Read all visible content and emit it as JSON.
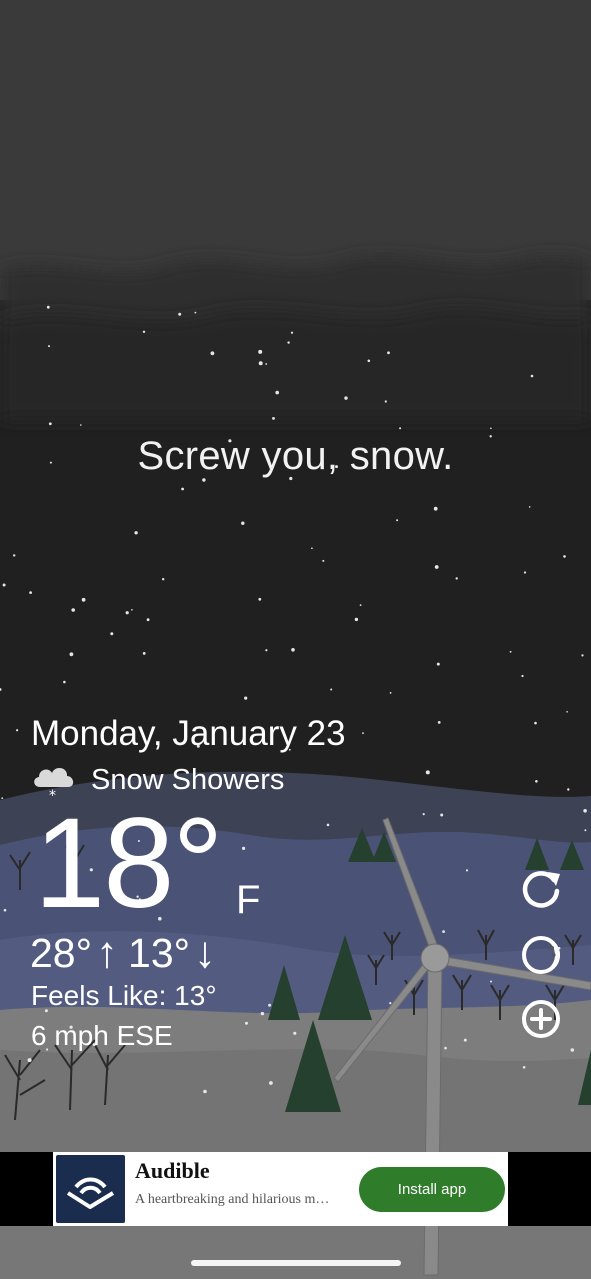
{
  "tagline": "Screw you, snow.",
  "weather": {
    "date": "Monday, January 23",
    "condition": "Snow Showers",
    "condition_icon": "snow-cloud-icon",
    "temperature": "18°",
    "unit": "F",
    "high": "28°",
    "high_arrow": "↑",
    "low": "13°",
    "low_arrow": "↓",
    "feels_like": "Feels Like: 13°",
    "wind": "6 mph ESE"
  },
  "controls": [
    {
      "icon": "refresh-icon"
    },
    {
      "icon": "moon-phase-icon"
    },
    {
      "icon": "add-location-icon"
    }
  ],
  "ad": {
    "title": "Audible",
    "description": "A heartbreaking and hilarious m…",
    "cta": "Install app",
    "cta_color": "#2f7d2a",
    "logo_color": "#1a2d4f"
  },
  "colors": {
    "sky_top": "#3a3a3a",
    "sky_bottom": "#202020",
    "hills": "#4c5578",
    "snow": "#7f7f7f"
  }
}
